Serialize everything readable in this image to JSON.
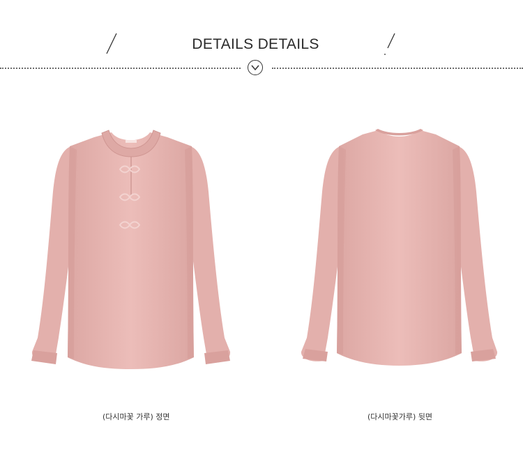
{
  "header": {
    "title": "DETAILS DETAILS"
  },
  "products": [
    {
      "caption": "(다시마꽃 가루) 정면"
    },
    {
      "caption": "(다시마꽃가루) 뒷면"
    }
  ],
  "colors": {
    "blouse": "#e9b7b3",
    "blouse_shadow": "#d9a19d",
    "dots": "#6a6a6a"
  }
}
